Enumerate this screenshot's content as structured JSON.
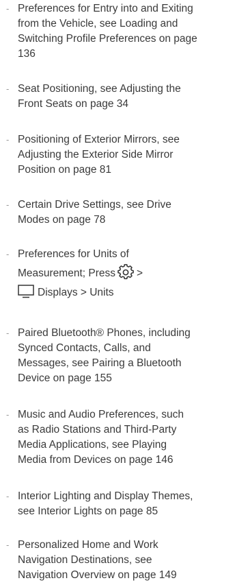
{
  "dash": "-",
  "items": [
    {
      "lines": [
        "Preferences for Entry into and Exiting",
        "from the Vehicle, see Loading and",
        "Switching Profile Preferences on page",
        "136"
      ]
    },
    {
      "lines": [
        "Seat Positioning, see Adjusting the",
        "Front Seats on page 34"
      ]
    },
    {
      "lines": [
        "Positioning of Exterior Mirrors, see",
        "Adjusting the Exterior Side Mirror",
        "Position on page 81"
      ]
    },
    {
      "lines": [
        "Certain Drive Settings, see Drive",
        "Modes on page 78"
      ]
    },
    {
      "line1": "Preferences for Units of",
      "line2_prefix": "Measurement; Press",
      "line2_suffix": ">",
      "line3": "Displays > Units",
      "icon_gear": "gear-icon",
      "icon_display": "monitor-icon"
    },
    {
      "lines": [
        "Paired Bluetooth® Phones, including",
        "Synced Contacts, Calls, and",
        "Messages, see Pairing a Bluetooth",
        "Device on page 155"
      ]
    },
    {
      "lines": [
        "Music and Audio Preferences, such",
        "as Radio Stations and Third-Party",
        "Media Applications, see Playing",
        "Media from Devices on page 146"
      ]
    },
    {
      "lines": [
        "Interior Lighting and Display Themes,",
        "see Interior Lights on page 85"
      ]
    },
    {
      "lines": [
        "Personalized Home and Work",
        "Navigation Destinations, see",
        "Navigation Overview on page 149"
      ]
    }
  ]
}
